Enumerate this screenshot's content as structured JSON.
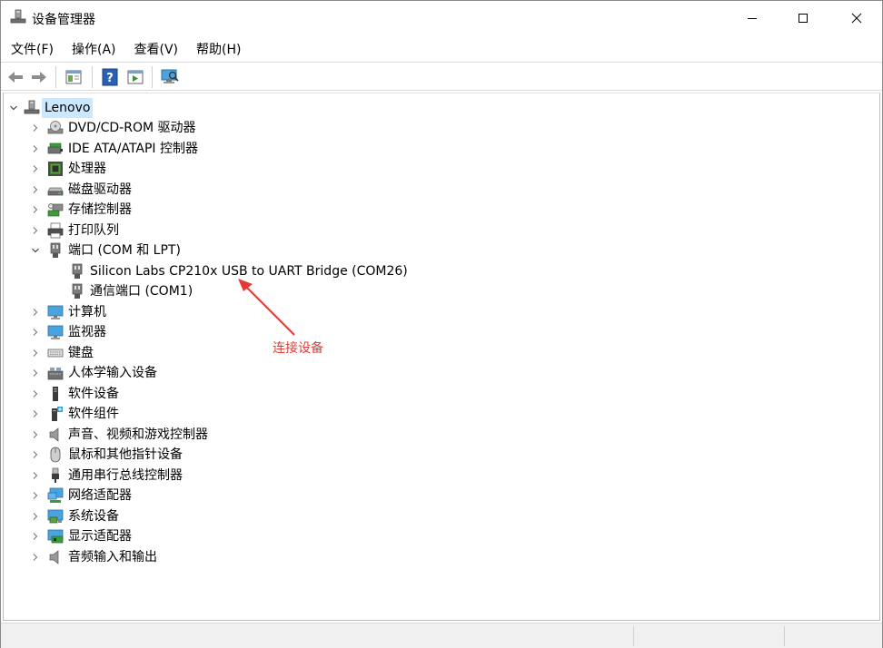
{
  "window": {
    "title": "设备管理器",
    "controls": {
      "minimize": "minimize",
      "maximize": "maximize",
      "close": "close"
    }
  },
  "menu": [
    "文件(F)",
    "操作(A)",
    "查看(V)",
    "帮助(H)"
  ],
  "toolbar": [
    "back-icon",
    "forward-icon",
    "properties-icon",
    "help-icon",
    "update-driver-icon",
    "scan-hardware-icon"
  ],
  "tree": {
    "root": {
      "label": "Lenovo",
      "icon": "computer-tower-icon",
      "expanded": true,
      "selected": true
    },
    "items": [
      {
        "label": "DVD/CD-ROM 驱动器",
        "icon": "dvd-drive-icon"
      },
      {
        "label": "IDE ATA/ATAPI 控制器",
        "icon": "ide-controller-icon"
      },
      {
        "label": "处理器",
        "icon": "processor-icon"
      },
      {
        "label": "磁盘驱动器",
        "icon": "disk-drive-icon"
      },
      {
        "label": "存储控制器",
        "icon": "storage-controller-icon"
      },
      {
        "label": "打印队列",
        "icon": "printer-icon"
      },
      {
        "label": "端口 (COM 和 LPT)",
        "icon": "port-icon",
        "expanded": true,
        "children": [
          {
            "label": "Silicon Labs CP210x USB to UART Bridge (COM26)",
            "icon": "port-icon"
          },
          {
            "label": "通信端口 (COM1)",
            "icon": "port-icon"
          }
        ]
      },
      {
        "label": "计算机",
        "icon": "monitor-icon"
      },
      {
        "label": "监视器",
        "icon": "monitor-icon"
      },
      {
        "label": "键盘",
        "icon": "keyboard-icon"
      },
      {
        "label": "人体学输入设备",
        "icon": "hid-icon"
      },
      {
        "label": "软件设备",
        "icon": "software-device-icon"
      },
      {
        "label": "软件组件",
        "icon": "software-component-icon"
      },
      {
        "label": "声音、视频和游戏控制器",
        "icon": "speaker-icon"
      },
      {
        "label": "鼠标和其他指针设备",
        "icon": "mouse-icon"
      },
      {
        "label": "通用串行总线控制器",
        "icon": "usb-icon"
      },
      {
        "label": "网络适配器",
        "icon": "network-adapter-icon"
      },
      {
        "label": "系统设备",
        "icon": "system-device-icon"
      },
      {
        "label": "显示适配器",
        "icon": "display-adapter-icon"
      },
      {
        "label": "音频输入和输出",
        "icon": "audio-io-icon"
      }
    ]
  },
  "annotation": {
    "text": "连接设备",
    "color": "#e53935"
  },
  "colors": {
    "selection": "#cce8ff",
    "accent": "#1e88e5"
  }
}
